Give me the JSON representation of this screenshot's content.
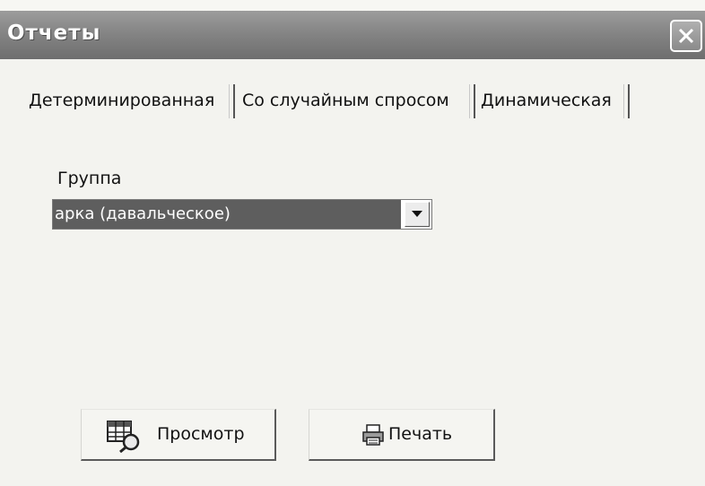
{
  "window": {
    "title": "Отчеты"
  },
  "tabs": [
    {
      "label": "Детерминированная"
    },
    {
      "label": "Со случайным спросом"
    },
    {
      "label": "Динамическая"
    }
  ],
  "group": {
    "label": "Группа",
    "selected": "арка (давальческое)"
  },
  "buttons": {
    "preview": "Просмотр",
    "print": "Печать"
  },
  "icons": {
    "close": "close-icon",
    "dropdown": "chevron-down-icon",
    "preview": "table-magnifier-icon",
    "print": "printer-icon"
  }
}
